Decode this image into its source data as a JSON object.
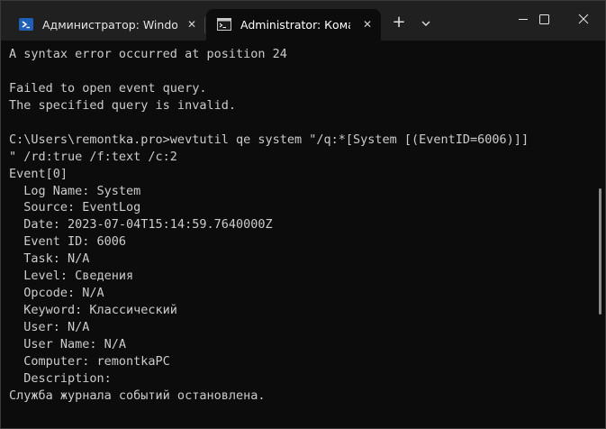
{
  "tabs": [
    {
      "label": "Администратор: Windows PowerShell",
      "icon": "powershell-icon"
    },
    {
      "label": "Administrator: Командная строка",
      "icon": "cmd-icon",
      "active": true
    }
  ],
  "tab_close_glyph": "✕",
  "new_tab_glyph": "+",
  "terminal": {
    "lines": [
      "A syntax error occurred at position 24",
      "",
      "Failed to open event query.",
      "The specified query is invalid.",
      "",
      "C:\\Users\\remontka.pro>wevtutil qe system \"/q:*[System [(EventID=6006)]]",
      "\" /rd:true /f:text /c:2",
      "Event[0]",
      "  Log Name: System",
      "  Source: EventLog",
      "  Date: 2023-07-04T15:14:59.7640000Z",
      "  Event ID: 6006",
      "  Task: N/A",
      "  Level: Сведения",
      "  Opcode: N/A",
      "  Keyword: Классический",
      "  User: N/A",
      "  User Name: N/A",
      "  Computer: remontkaPC",
      "  Description:",
      "Служба журнала событий остановлена."
    ]
  },
  "colors": {
    "terminal_bg": "#0c0c0c",
    "titlebar_bg": "#202020",
    "text": "#cccccc"
  }
}
